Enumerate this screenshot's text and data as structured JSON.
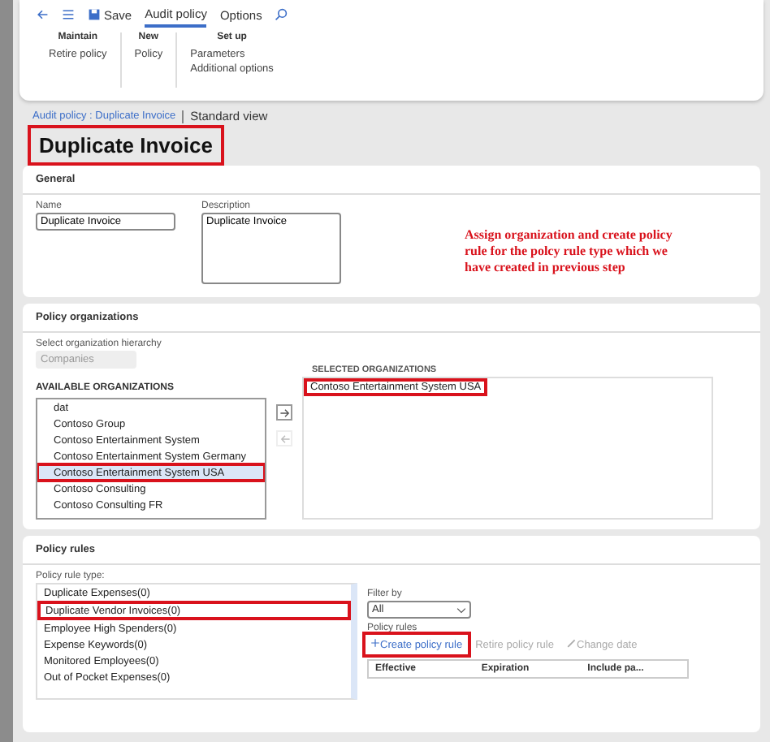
{
  "toolbar": {
    "save": "Save",
    "tabs": [
      {
        "label": "Audit policy",
        "selected": true
      },
      {
        "label": "Options",
        "selected": false
      }
    ]
  },
  "ribbon": [
    {
      "title": "Maintain",
      "items": [
        "Retire policy"
      ]
    },
    {
      "title": "New",
      "items": [
        "Policy"
      ]
    },
    {
      "title": "Set up",
      "items": [
        "Parameters",
        "Additional options"
      ]
    }
  ],
  "breadcrumb": {
    "link": "Audit policy : Duplicate Invoice",
    "view": "Standard view"
  },
  "title": {
    "text": "Duplicate Invoice",
    "highlighted": true
  },
  "general": {
    "heading": "General",
    "name_label": "Name",
    "name": "Duplicate Invoice",
    "description_label": "Description",
    "description": "Duplicate Invoice"
  },
  "note": "Assign organization and create policy rule for the polcy rule type which we have created in previous step",
  "organizations": {
    "heading": "Policy organizations",
    "hierarchy_label": "Select organization hierarchy",
    "hierarchy": "Companies",
    "available_label": "AVAILABLE ORGANIZATIONS",
    "selected_label": "SELECTED ORGANIZATIONS",
    "available": [
      {
        "name": "dat",
        "selected": false,
        "highlighted": false
      },
      {
        "name": "Contoso Group",
        "selected": false,
        "highlighted": false
      },
      {
        "name": "Contoso Entertainment System",
        "selected": false,
        "highlighted": false
      },
      {
        "name": "Contoso Entertainment System Germany",
        "selected": false,
        "highlighted": false
      },
      {
        "name": "Contoso Entertainment System USA",
        "selected": true,
        "highlighted": true
      },
      {
        "name": "Contoso Consulting",
        "selected": false,
        "highlighted": false
      },
      {
        "name": "Contoso Consulting FR",
        "selected": false,
        "highlighted": false
      }
    ],
    "chosen": [
      {
        "name": "Contoso Entertainment System USA",
        "highlighted": true
      }
    ]
  },
  "rules": {
    "heading": "Policy rules",
    "type_label": "Policy rule type:",
    "types": [
      {
        "name": "Duplicate Expenses(0)",
        "selected": false,
        "highlighted": false
      },
      {
        "name": "Duplicate Vendor Invoices(0)",
        "selected": true,
        "highlighted": true
      },
      {
        "name": "Employee High Spenders(0)",
        "selected": false,
        "highlighted": false
      },
      {
        "name": "Expense Keywords(0)",
        "selected": false,
        "highlighted": false
      },
      {
        "name": "Monitored Employees(0)",
        "selected": false,
        "highlighted": false
      },
      {
        "name": "Out of Pocket Expenses(0)",
        "selected": false,
        "highlighted": false
      }
    ],
    "filter_label": "Filter by",
    "filter": "All",
    "rules_label": "Policy rules",
    "actions": [
      {
        "label": "Create policy rule",
        "disabled": false,
        "highlighted": true
      },
      {
        "label": "Retire policy rule",
        "disabled": true,
        "highlighted": false
      },
      {
        "label": "Change date",
        "disabled": true,
        "highlighted": false
      }
    ],
    "columns": [
      "Effective",
      "Expiration",
      "Include pa..."
    ]
  }
}
